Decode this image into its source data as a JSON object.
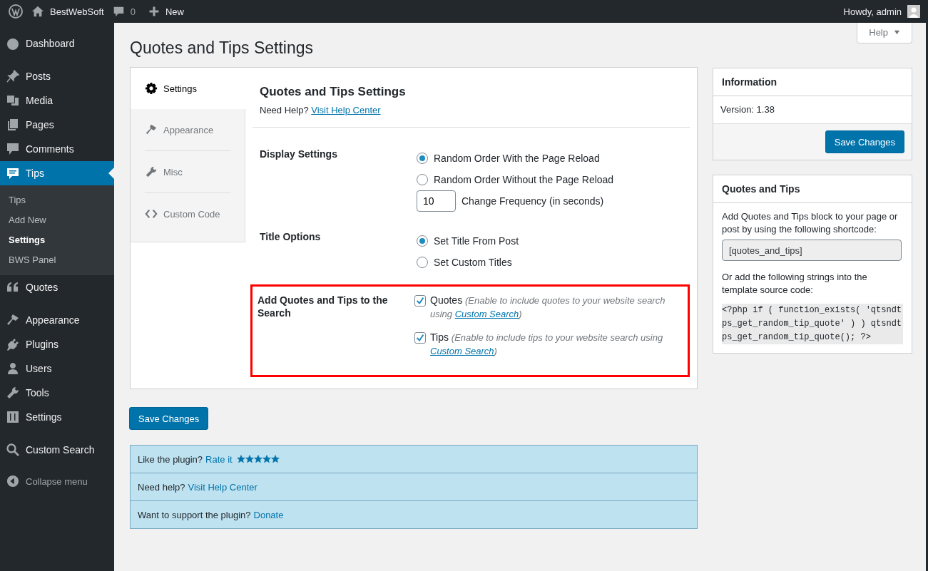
{
  "admin_bar": {
    "site_name": "BestWebSoft",
    "comments_count": "0",
    "new_label": "New",
    "greeting": "Howdy, admin"
  },
  "sidebar": {
    "sections": [
      {
        "items": [
          {
            "label": "Dashboard",
            "selected": false
          }
        ]
      },
      {
        "items": [
          {
            "label": "Posts",
            "selected": false
          },
          {
            "label": "Media",
            "selected": false
          },
          {
            "label": "Pages",
            "selected": false
          },
          {
            "label": "Comments",
            "selected": false
          },
          {
            "label": "Tips",
            "selected": true,
            "children": [
              {
                "label": "Tips",
                "selected": false
              },
              {
                "label": "Add New",
                "selected": false
              },
              {
                "label": "Settings",
                "selected": true
              },
              {
                "label": "BWS Panel",
                "selected": false
              }
            ]
          },
          {
            "label": "Quotes",
            "selected": false
          }
        ]
      },
      {
        "items": [
          {
            "label": "Appearance",
            "selected": false
          },
          {
            "label": "Plugins",
            "selected": false
          },
          {
            "label": "Users",
            "selected": false
          },
          {
            "label": "Tools",
            "selected": false
          },
          {
            "label": "Settings",
            "selected": false
          }
        ]
      },
      {
        "items": [
          {
            "label": "Custom Search",
            "selected": false
          }
        ]
      }
    ],
    "collapse_label": "Collapse menu"
  },
  "help_button": "Help",
  "page_title": "Quotes and Tips Settings",
  "tabs": [
    {
      "label": "Settings",
      "selected": true
    },
    {
      "label": "Appearance",
      "selected": false
    },
    {
      "label": "Misc",
      "selected": false
    },
    {
      "label": "Custom Code",
      "selected": false
    }
  ],
  "panel": {
    "title": "Quotes and Tips Settings",
    "help_prompt": "Need Help?",
    "help_link": "Visit Help Center",
    "rows": [
      {
        "label": "Display Settings",
        "kind": "radio",
        "options": [
          {
            "label": "Random Order With the Page Reload",
            "selected": true
          },
          {
            "label": "Random Order Without the Page Reload",
            "selected": false
          }
        ],
        "frequency": {
          "value": "10",
          "label": "Change Frequency (in seconds)"
        }
      },
      {
        "label": "Title Options",
        "kind": "radio",
        "options": [
          {
            "label": "Set Title From Post",
            "selected": true
          },
          {
            "label": "Set Custom Titles",
            "selected": false
          }
        ]
      },
      {
        "label": "Add Quotes and Tips to the Search",
        "kind": "checkbox",
        "highlighted": true,
        "options": [
          {
            "label": "Quotes",
            "checked": true,
            "note": "(Enable to include quotes to your website search using",
            "link": "Custom Search",
            "note_end": ")"
          },
          {
            "label": "Tips",
            "checked": true,
            "note": "(Enable to include tips to your website search using",
            "link": "Custom Search",
            "note_end": ")"
          }
        ]
      }
    ]
  },
  "save_button": "Save Changes",
  "notices": [
    {
      "text": "Like the plugin?",
      "link": "Rate it",
      "stars": 5
    },
    {
      "text": "Need help?",
      "link": "Visit Help Center"
    },
    {
      "text": "Want to support the plugin?",
      "link": "Donate"
    }
  ],
  "info_box": {
    "title": "Information",
    "version_label": "Version:",
    "version": "1.38",
    "save_button": "Save Changes"
  },
  "shortcode_box": {
    "title": "Quotes and Tips",
    "intro": "Add Quotes and Tips block to your page or post by using the following shortcode:",
    "shortcode": "[quotes_and_tips]",
    "outro": "Or add the following strings into the template source code:",
    "code": " <?php if ( function_exists( 'qtsndtps_get_random_tip_quote' ) ) qtsndtps_get_random_tip_quote(); ?>"
  }
}
